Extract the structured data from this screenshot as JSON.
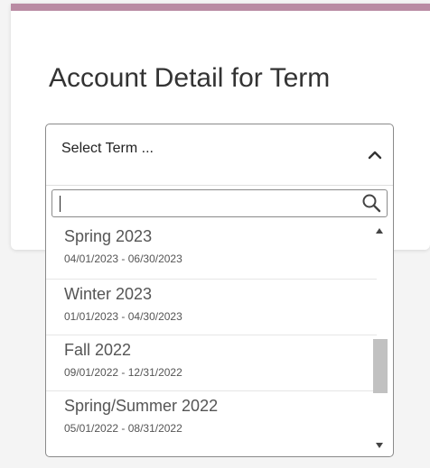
{
  "page": {
    "title": "Account Detail for Term"
  },
  "term_select": {
    "placeholder": "Select Term ...",
    "search_value": "",
    "expanded": true,
    "options": [
      {
        "name": "Spring 2023",
        "dates": "04/01/2023 - 06/30/2023"
      },
      {
        "name": "Winter 2023",
        "dates": "01/01/2023 - 04/30/2023"
      },
      {
        "name": "Fall 2022",
        "dates": "09/01/2022 - 12/31/2022"
      },
      {
        "name": "Spring/Summer 2022",
        "dates": "05/01/2022 - 08/31/2022"
      }
    ]
  },
  "icons": {
    "chevron": "chevron-up-icon",
    "search": "search-icon",
    "scroll_up": "scroll-up-arrow-icon",
    "scroll_down": "scroll-down-arrow-icon"
  },
  "colors": {
    "accent": "#b98ba3",
    "text": "#333333",
    "muted_text": "#555555"
  }
}
